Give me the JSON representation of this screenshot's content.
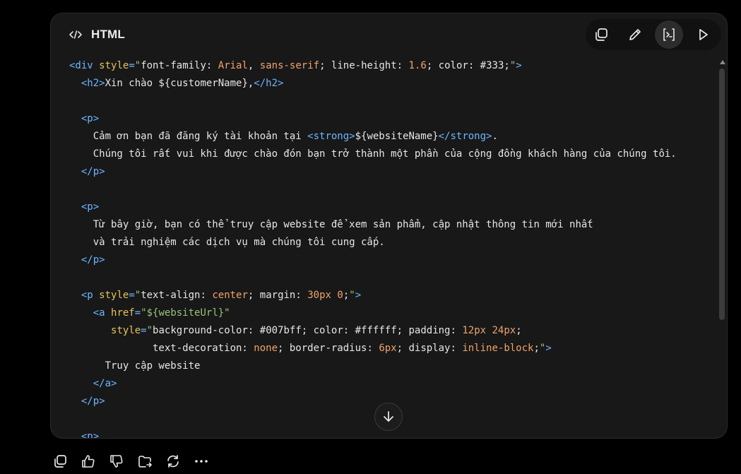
{
  "header": {
    "language": "HTML",
    "lang_icon": "code-brackets-icon"
  },
  "toolbar": {
    "buttons": [
      {
        "name": "copy-icon",
        "active": false
      },
      {
        "name": "pencil-icon",
        "active": false
      },
      {
        "name": "terminal-icon",
        "active": true
      },
      {
        "name": "play-icon",
        "active": false
      }
    ]
  },
  "code": {
    "lines": [
      [
        [
          "tag",
          "<div "
        ],
        [
          "attr",
          "style"
        ],
        [
          "tag",
          "="
        ],
        [
          "str",
          "\""
        ],
        [
          "txt",
          "font-family: "
        ],
        [
          "val",
          "Arial"
        ],
        [
          "txt",
          ", "
        ],
        [
          "val",
          "sans-serif"
        ],
        [
          "txt",
          "; line-height: "
        ],
        [
          "val",
          "1.6"
        ],
        [
          "txt",
          "; color: #333;"
        ],
        [
          "str",
          "\""
        ],
        [
          "tag",
          ">"
        ]
      ],
      [
        [
          "txt",
          "  "
        ],
        [
          "tag",
          "<h2>"
        ],
        [
          "txt",
          "Xin chào ${customerName},"
        ],
        [
          "tag",
          "</h2>"
        ]
      ],
      [
        [
          "txt",
          ""
        ]
      ],
      [
        [
          "txt",
          "  "
        ],
        [
          "tag",
          "<p>"
        ]
      ],
      [
        [
          "txt",
          "    Cảm ơn bạn đã đăng ký tài khoản tại "
        ],
        [
          "tag",
          "<strong>"
        ],
        [
          "txt",
          "${websiteName}"
        ],
        [
          "tag",
          "</strong>"
        ],
        [
          "txt",
          "."
        ]
      ],
      [
        [
          "txt",
          "    Chúng tôi rất vui khi được chào đón bạn trở thành một phần của cộng đồng khách hàng của chúng tôi."
        ]
      ],
      [
        [
          "txt",
          "  "
        ],
        [
          "tag",
          "</p>"
        ]
      ],
      [
        [
          "txt",
          ""
        ]
      ],
      [
        [
          "txt",
          "  "
        ],
        [
          "tag",
          "<p>"
        ]
      ],
      [
        [
          "txt",
          "    Từ bây giờ, bạn có thể truy cập website để xem sản phẩm, cập nhật thông tin mới nhất"
        ]
      ],
      [
        [
          "txt",
          "    và trải nghiệm các dịch vụ mà chúng tôi cung cấp."
        ]
      ],
      [
        [
          "txt",
          "  "
        ],
        [
          "tag",
          "</p>"
        ]
      ],
      [
        [
          "txt",
          ""
        ]
      ],
      [
        [
          "txt",
          "  "
        ],
        [
          "tag",
          "<p "
        ],
        [
          "attr",
          "style"
        ],
        [
          "tag",
          "="
        ],
        [
          "str",
          "\""
        ],
        [
          "txt",
          "text-align: "
        ],
        [
          "val",
          "center"
        ],
        [
          "txt",
          "; margin: "
        ],
        [
          "val",
          "30px"
        ],
        [
          "txt",
          " "
        ],
        [
          "val",
          "0"
        ],
        [
          "txt",
          ";"
        ],
        [
          "str",
          "\""
        ],
        [
          "tag",
          ">"
        ]
      ],
      [
        [
          "txt",
          "    "
        ],
        [
          "tag",
          "<a "
        ],
        [
          "attr",
          "href"
        ],
        [
          "tag",
          "="
        ],
        [
          "str",
          "\"${websiteUrl}\""
        ]
      ],
      [
        [
          "txt",
          "       "
        ],
        [
          "attr",
          "style"
        ],
        [
          "tag",
          "="
        ],
        [
          "str",
          "\""
        ],
        [
          "txt",
          "background-color: #007bff; color: #ffffff; padding: "
        ],
        [
          "val",
          "12px"
        ],
        [
          "txt",
          " "
        ],
        [
          "val",
          "24px"
        ],
        [
          "txt",
          ";"
        ]
      ],
      [
        [
          "txt",
          "              text-decoration: "
        ],
        [
          "val",
          "none"
        ],
        [
          "txt",
          "; border-radius: "
        ],
        [
          "val",
          "6px"
        ],
        [
          "txt",
          "; display: "
        ],
        [
          "val",
          "inline-block"
        ],
        [
          "txt",
          ";"
        ],
        [
          "str",
          "\""
        ],
        [
          "tag",
          ">"
        ]
      ],
      [
        [
          "txt",
          "      Truy cập website"
        ]
      ],
      [
        [
          "txt",
          "    "
        ],
        [
          "tag",
          "</a>"
        ]
      ],
      [
        [
          "txt",
          "  "
        ],
        [
          "tag",
          "</p>"
        ]
      ],
      [
        [
          "txt",
          ""
        ]
      ],
      [
        [
          "txt",
          "  "
        ],
        [
          "tag",
          "<p>"
        ]
      ]
    ]
  },
  "scroll_down_icon": "arrow-down-icon",
  "actions": [
    {
      "name": "copy-icon"
    },
    {
      "name": "thumbs-up-icon"
    },
    {
      "name": "thumbs-down-icon"
    },
    {
      "name": "share-folder-icon"
    },
    {
      "name": "regenerate-icon"
    },
    {
      "name": "more-icon"
    }
  ]
}
